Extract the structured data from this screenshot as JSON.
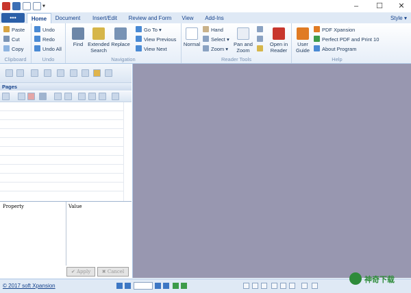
{
  "window": {
    "controls": {
      "minimize": "–",
      "maximize": "☐",
      "close": "✕"
    }
  },
  "tabs": {
    "file": "•••",
    "items": [
      "Home",
      "Document",
      "Insert/Edit",
      "Review and Form",
      "View",
      "Add-Ins"
    ],
    "style_label": "Style"
  },
  "ribbon": {
    "clipboard": {
      "label": "Clipboard",
      "paste": "Paste",
      "cut": "Cut",
      "copy": "Copy"
    },
    "undo": {
      "label": "Undo",
      "undo": "Undo",
      "redo": "Redo",
      "undo_all": "Undo All"
    },
    "navigation": {
      "label": "Navigation",
      "find": "Find",
      "extended_search_1": "Extended",
      "extended_search_2": "Search",
      "replace": "Replace",
      "go_to": "Go To",
      "view_previous": "View Previous",
      "view_next": "View Next"
    },
    "reader_tools": {
      "label": "Reader Tools",
      "normal": "Normal",
      "hand": "Hand",
      "select": "Select",
      "zoom": "Zoom",
      "pan_zoom_1": "Pan and",
      "pan_zoom_2": "Zoom",
      "open_reader_1": "Open in",
      "open_reader_2": "Reader"
    },
    "help": {
      "label": "Help",
      "user_guide_1": "User",
      "user_guide_2": "Guide",
      "pdf_xpansion": "PDF Xpansion",
      "perfect_pdf": "Perfect PDF and Print 10",
      "about": "About Program"
    }
  },
  "pages_panel": {
    "title": "Pages"
  },
  "property_grid": {
    "property_header": "Property",
    "value_header": "Value",
    "apply": "Apply",
    "cancel": "Cancel"
  },
  "status": {
    "copyright": "© 2017 soft Xpansion"
  },
  "watermark": {
    "text": "神奇下载"
  }
}
